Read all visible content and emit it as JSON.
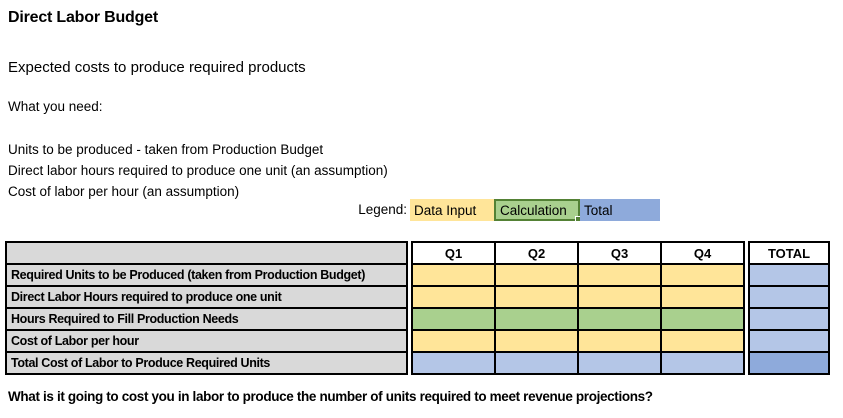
{
  "page": {
    "title": "Direct Labor Budget",
    "subtitle": "Expected costs to produce required products",
    "what_you_need_label": "What you need:",
    "requirements": [
      "Units to be produced - taken from Production Budget",
      "Direct labor hours required to produce one unit (an assumption)",
      "Cost of labor per hour (an assumption)"
    ],
    "footer_question": "What is it going to cost you in labor to produce the number of units required to meet revenue projections?"
  },
  "legend": {
    "label": "Legend:",
    "items": [
      {
        "label": "Data Input",
        "color_key": "data_input",
        "selected": false
      },
      {
        "label": "Calculation",
        "color_key": "calculation",
        "selected": true
      },
      {
        "label": "Total",
        "color_key": "total_dark",
        "selected": false
      }
    ]
  },
  "table": {
    "columns": [
      "Q1",
      "Q2",
      "Q3",
      "Q4",
      "TOTAL"
    ],
    "rows": [
      {
        "label": "Required Units to be Produced (taken from Production Budget)",
        "cell_type": "data_input",
        "total_type": "total_light",
        "values": [
          "",
          "",
          "",
          "",
          ""
        ]
      },
      {
        "label": "Direct Labor Hours required to produce one unit",
        "cell_type": "data_input",
        "total_type": "total_light",
        "values": [
          "",
          "",
          "",
          "",
          ""
        ]
      },
      {
        "label": "Hours Required to Fill Production Needs",
        "cell_type": "calculation",
        "total_type": "total_light",
        "values": [
          "",
          "",
          "",
          "",
          ""
        ]
      },
      {
        "label": "Cost of Labor per hour",
        "cell_type": "data_input",
        "total_type": "total_light",
        "values": [
          "",
          "",
          "",
          "",
          ""
        ]
      },
      {
        "label": "Total Cost of Labor to Produce Required Units",
        "cell_type": "total_light",
        "total_type": "total_dark",
        "values": [
          "",
          "",
          "",
          "",
          ""
        ]
      }
    ]
  },
  "colors": {
    "data_input": "#FFE599",
    "calculation": "#A9D08E",
    "total_light": "#B4C6E7",
    "total_dark": "#8EAADB",
    "label_bg": "#D9D9D9",
    "selection_border": "#538135",
    "grid_border": "#000000"
  }
}
